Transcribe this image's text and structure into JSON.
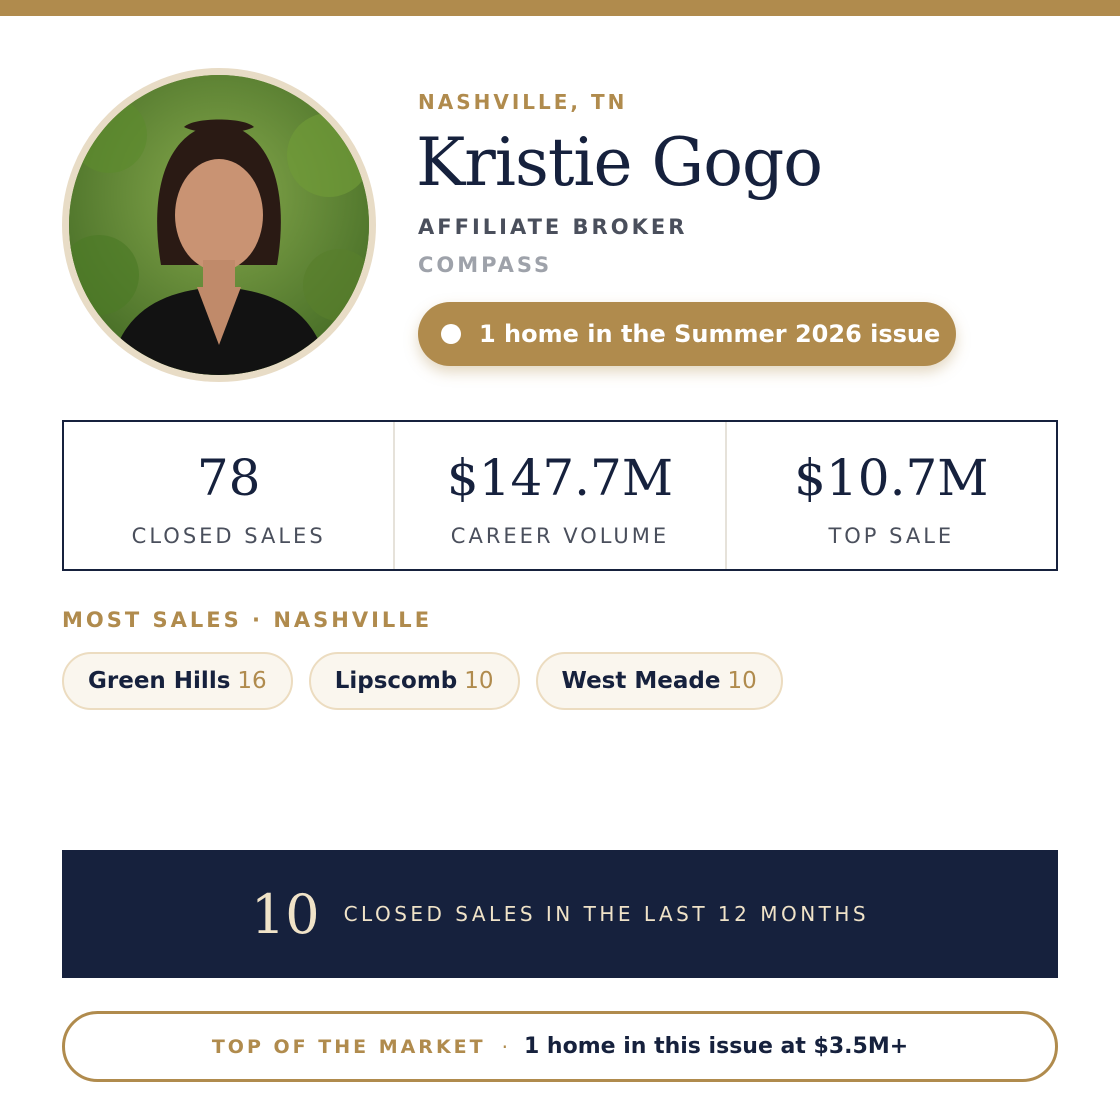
{
  "brand": {
    "accent": "#b08b4d",
    "navy": "#16213d",
    "cream": "#f0e3c8"
  },
  "agent": {
    "photo_icon": "agent-portrait",
    "location": "NASHVILLE, TN",
    "name": "Kristie Gogo",
    "title": "AFFILIATE BROKER",
    "brokerage": "COMPASS",
    "issue_badge": "1 home in the Summer 2026 issue"
  },
  "stats": [
    {
      "value": "78",
      "label": "CLOSED SALES"
    },
    {
      "value": "$147.7M",
      "label": "CAREER VOLUME"
    },
    {
      "value": "$10.7M",
      "label": "TOP SALE"
    }
  ],
  "most_sales": {
    "title": "MOST SALES · NASHVILLE",
    "neighborhoods": [
      {
        "name": "Green Hills",
        "count": "16"
      },
      {
        "name": "Lipscomb",
        "count": "10"
      },
      {
        "name": "West Meade",
        "count": "10"
      }
    ]
  },
  "recent": {
    "count": "10",
    "label": "CLOSED SALES IN THE LAST 12 MONTHS"
  },
  "market": {
    "label": "TOP OF THE MARKET",
    "separator": "·",
    "text": "1 home in this issue at $3.5M+"
  }
}
